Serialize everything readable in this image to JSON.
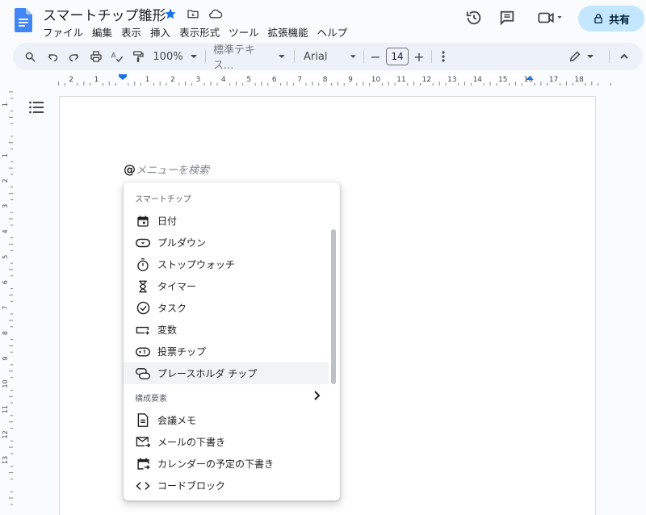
{
  "app": {
    "doc_title": "スマートチップ雛形",
    "share_label": "共有"
  },
  "menubar": [
    "ファイル",
    "編集",
    "表示",
    "挿入",
    "表示形式",
    "ツール",
    "拡張機能",
    "ヘルプ"
  ],
  "toolbar": {
    "zoom": "100%",
    "style": "標準テキス...",
    "font": "Arial",
    "font_size": "14",
    "minus": "−",
    "plus": "+"
  },
  "ruler": {
    "h_labels": [
      "2",
      "1",
      "1",
      "2",
      "3",
      "4",
      "5",
      "6",
      "7",
      "8",
      "9",
      "10",
      "11",
      "12",
      "13",
      "14",
      "15",
      "16",
      "17",
      "18"
    ],
    "v_labels": [
      "2",
      "1",
      "1",
      "2",
      "3",
      "4",
      "5",
      "6",
      "7",
      "8",
      "9",
      "10",
      "11",
      "12",
      "13"
    ]
  },
  "editor": {
    "at_symbol": "@",
    "search_placeholder": "メニューを検索"
  },
  "smart_chip_menu": {
    "section1_title": "スマートチップ",
    "items1": [
      {
        "label": "日付",
        "icon": "calendar-icon"
      },
      {
        "label": "プルダウン",
        "icon": "dropdown-chip-icon"
      },
      {
        "label": "ストップウォッチ",
        "icon": "stopwatch-icon"
      },
      {
        "label": "タイマー",
        "icon": "hourglass-icon"
      },
      {
        "label": "タスク",
        "icon": "check-circle-icon"
      },
      {
        "label": "変数",
        "icon": "variable-icon"
      },
      {
        "label": "投票チップ",
        "icon": "voting-chip-icon"
      },
      {
        "label": "プレースホルダ チップ",
        "icon": "placeholder-chip-icon"
      }
    ],
    "section2_title": "構成要素",
    "items2": [
      {
        "label": "会議メモ",
        "icon": "document-icon"
      },
      {
        "label": "メールの下書き",
        "icon": "email-draft-icon"
      },
      {
        "label": "カレンダーの予定の下書き",
        "icon": "calendar-draft-icon"
      },
      {
        "label": "コードブロック",
        "icon": "code-icon"
      }
    ]
  },
  "colors": {
    "accent": "#1a73e8",
    "share_bg": "#c2e7ff",
    "toolbar_bg": "#edf2fa"
  }
}
